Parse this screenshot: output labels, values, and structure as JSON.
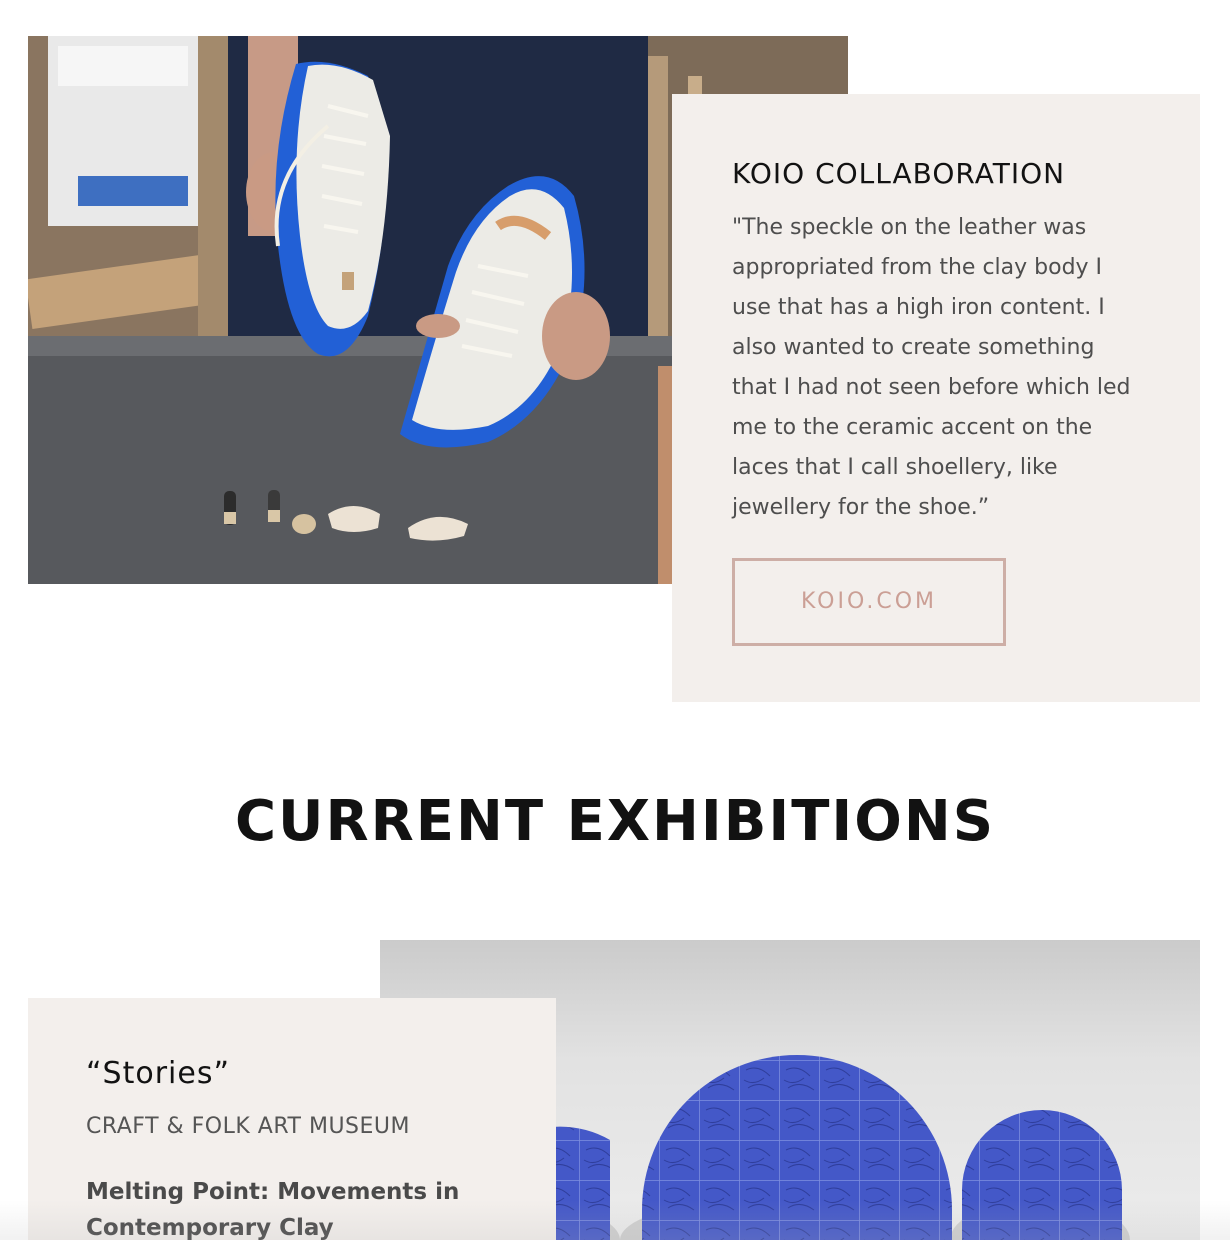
{
  "koio": {
    "title": "KOIO COLLABORATION",
    "quote": "\"The speckle on the leather was appropriated from the clay body I use that has a high iron content. I also wanted to create something that I had not seen before which led me to the ceramic accent on the laces that I call shoellery, like jewellery for the shoe.”",
    "button_label": "KOIO.COM",
    "photo_alt": "Hands holding white sneakers with blue soles over a workbench with ceramic lace accents"
  },
  "exhibitions": {
    "heading": "CURRENT EXHIBITIONS",
    "items": [
      {
        "title": "“Stories”",
        "venue": "CRAFT & FOLK ART MUSEUM",
        "show": "Melting Point: Movements in Contemporary Clay"
      }
    ],
    "photo_alt": "Three blue ceramic tile arches in a gallery"
  },
  "colors": {
    "card_bg": "#f3efec",
    "button_border": "#cdaea6",
    "button_text": "#cb9f95",
    "heading": "#121212",
    "sole_blue": "#2260d6",
    "tile_blue": "#4458c8"
  }
}
